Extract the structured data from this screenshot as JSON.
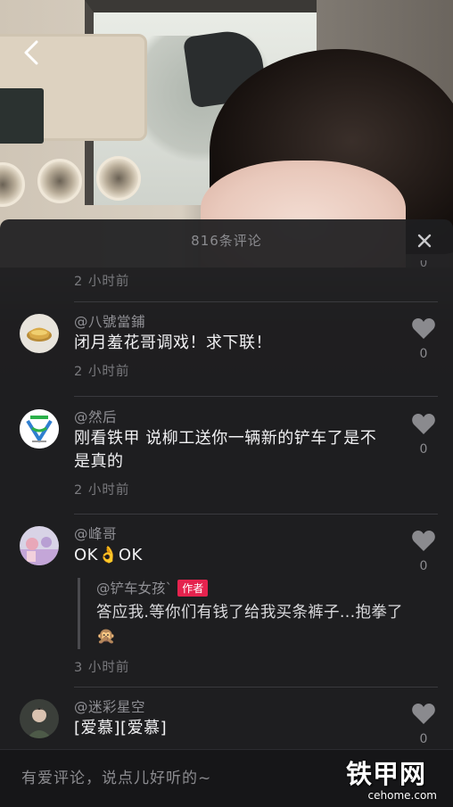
{
  "header": {
    "comment_count_title": "816条评论"
  },
  "top_partial": {
    "time": "2 小时前",
    "like_count": "0"
  },
  "comments": [
    {
      "username": "@八號當鋪",
      "text": "闭月羞花哥调戏！求下联！",
      "time": "2 小时前",
      "like_count": "0"
    },
    {
      "username": "@然后",
      "text": "刚看铁甲 说柳工送你一辆新的铲车了是不是真的",
      "time": "2 小时前",
      "like_count": "0"
    },
    {
      "username": "@峰哥",
      "text": "OK👌OK",
      "time": "3 小时前",
      "like_count": "0",
      "reply": {
        "username": "@铲车女孩`",
        "badge": "作者",
        "text": "答应我.等你们有钱了给我买条裤子...抱拳了🙊"
      }
    },
    {
      "username": "@迷彩星空",
      "text": "[爱慕][爱慕]",
      "like_count": "0"
    }
  ],
  "input": {
    "placeholder": "有爱评论，说点儿好听的~"
  },
  "watermark": {
    "main": "铁甲网",
    "sub": "cehome.com"
  },
  "colors": {
    "sheet_bg": "#1e1e20",
    "author_badge": "#e5234e",
    "text_primary": "#f1f1f3",
    "text_secondary": "#8b8b8f"
  }
}
